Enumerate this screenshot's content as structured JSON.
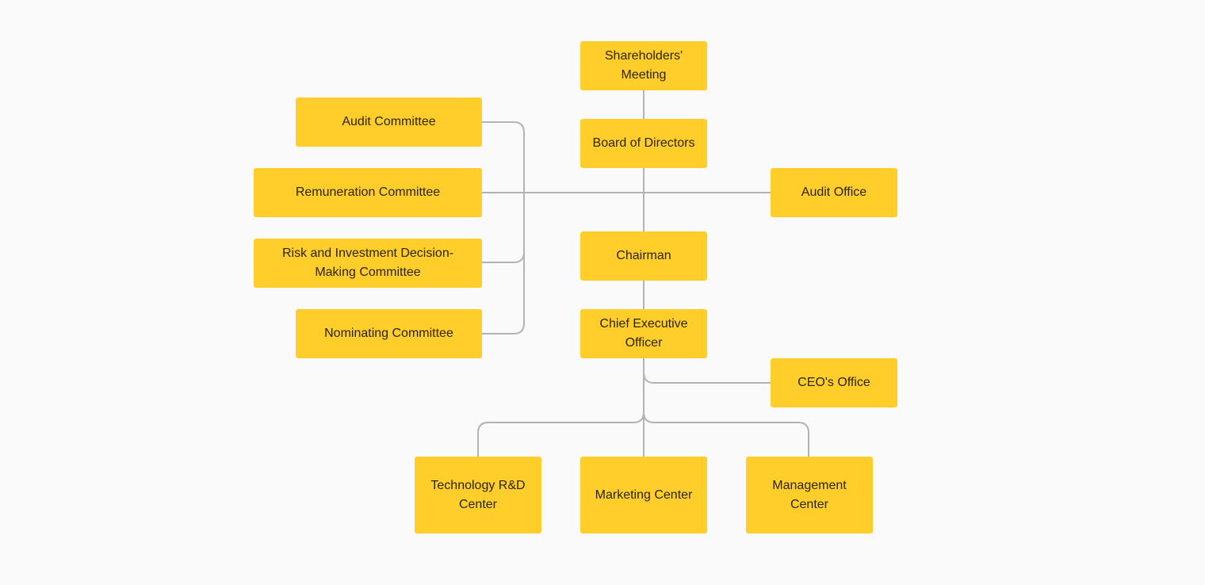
{
  "colors": {
    "background": "#fafafa",
    "node_fill": "#ffce2b",
    "connector": "#b3b3b3",
    "text": "#2b2410"
  },
  "diagram": {
    "type": "org-chart",
    "nodes": {
      "shareholders": "Shareholders'\nMeeting",
      "board": "Board of Directors",
      "audit_committee": "Audit Committee",
      "remuneration_committee": "Remuneration Committee",
      "risk_committee": "Risk and Investment Decision-\nMaking Committee",
      "nominating_committee": "Nominating Committee",
      "audit_office": "Audit Office",
      "chairman": "Chairman",
      "ceo": "Chief Executive\nOfficer",
      "ceo_office": "CEO's Office",
      "tech_center": "Technology R&D\nCenter",
      "marketing_center": "Marketing Center",
      "management_center": "Management\nCenter"
    },
    "edges": [
      [
        "shareholders",
        "board"
      ],
      [
        "board",
        "audit_committee"
      ],
      [
        "board",
        "remuneration_committee"
      ],
      [
        "board",
        "risk_committee"
      ],
      [
        "board",
        "nominating_committee"
      ],
      [
        "board",
        "audit_office"
      ],
      [
        "board",
        "chairman"
      ],
      [
        "chairman",
        "ceo"
      ],
      [
        "ceo",
        "ceo_office"
      ],
      [
        "ceo",
        "tech_center"
      ],
      [
        "ceo",
        "marketing_center"
      ],
      [
        "ceo",
        "management_center"
      ]
    ]
  }
}
